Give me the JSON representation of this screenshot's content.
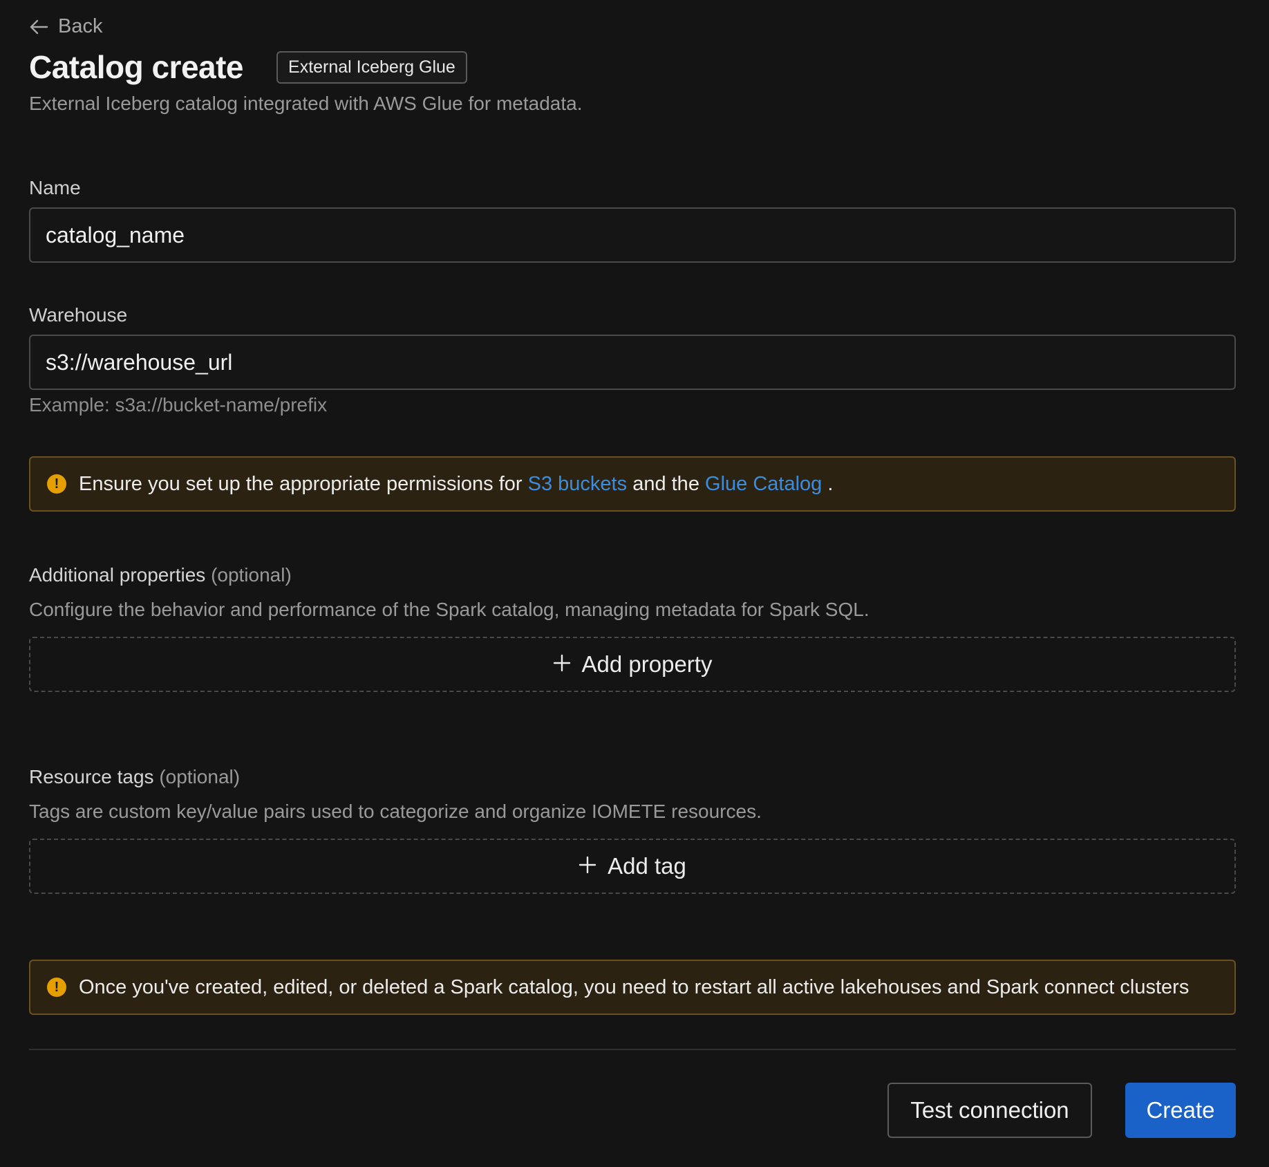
{
  "nav": {
    "back_label": "Back"
  },
  "header": {
    "title": "Catalog create",
    "badge": "External Iceberg Glue",
    "subtitle": "External Iceberg catalog integrated with AWS Glue for metadata."
  },
  "form": {
    "name": {
      "label": "Name",
      "value": "catalog_name"
    },
    "warehouse": {
      "label": "Warehouse",
      "value": "s3://warehouse_url",
      "helper": "Example: s3a://bucket-name/prefix"
    }
  },
  "permissions_alert": {
    "text_before": "Ensure you set up the appropriate permissions for",
    "link1": "S3 buckets",
    "text_middle": "and the",
    "link2": "Glue Catalog",
    "text_after": "."
  },
  "additional_properties": {
    "title": "Additional properties",
    "optional": "(optional)",
    "description": "Configure the behavior and performance of the Spark catalog, managing metadata for Spark SQL.",
    "add_label": "Add property"
  },
  "resource_tags": {
    "title": "Resource tags",
    "optional": "(optional)",
    "description": "Tags are custom key/value pairs used to categorize and organize IOMETE resources.",
    "add_label": "Add tag"
  },
  "restart_alert": {
    "text": "Once you've created, edited, or deleted a Spark catalog, you need to restart all active lakehouses and Spark connect clusters"
  },
  "footer": {
    "test_label": "Test connection",
    "create_label": "Create"
  },
  "colors": {
    "background": "#141414",
    "warning_bg": "#2b2212",
    "warning_border": "#6a5220",
    "warning_icon": "#e5a000",
    "link": "#3d8ddf",
    "primary": "#1a62c7"
  },
  "icons": {
    "back": "arrow-left-icon",
    "warning": "warning-circle-icon",
    "add": "plus-icon"
  }
}
